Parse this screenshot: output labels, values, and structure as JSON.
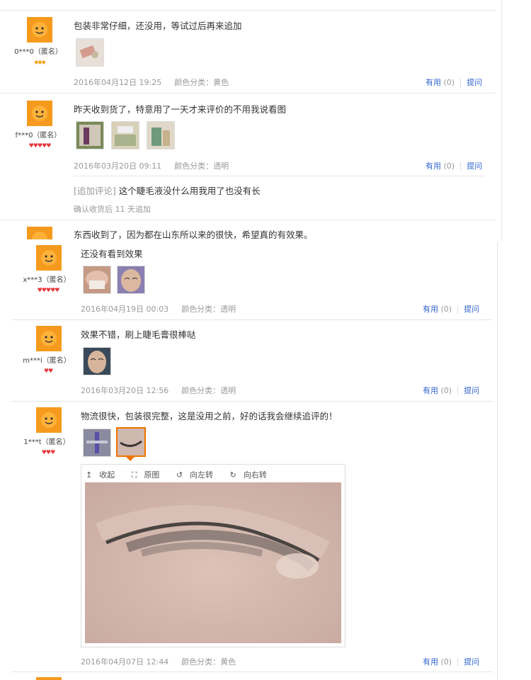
{
  "reviews": [
    {
      "user": "0***0（匿名）",
      "content": "包装非常仔细，还没用，等试过后再来追加",
      "date": "2016年04月12日 19:25",
      "color_label": "颜色分类：",
      "color_value": "黄色",
      "useful_label": "有用",
      "useful_count": "(0)",
      "ask_label": "提问",
      "rank": "◆◆◆"
    },
    {
      "user": "f***0（匿名）",
      "content": "昨天收到货了，特意用了一天才来评价的不用我说看图",
      "date": "2016年03月20日 09:11",
      "color_label": "颜色分类：",
      "color_value": "透明",
      "useful_label": "有用",
      "useful_count": "(0)",
      "ask_label": "提问",
      "append_label": "[追加评论]",
      "append_text": "这个睫毛液没什么用我用了也没有长",
      "append_meta": "确认收货后 11 天追加",
      "rank": "♥♥♥♥♥"
    },
    {
      "content": "东西收到了，因为都在山东所以来的很快，希望真的有效果。"
    },
    {
      "user": "x***3（匿名）",
      "content": "还没有看到效果",
      "date": "2016年04月19日 00:03",
      "color_label": "颜色分类：",
      "color_value": "透明",
      "useful_label": "有用",
      "useful_count": "(0)",
      "ask_label": "提问",
      "rank": "♥♥♥♥♥"
    },
    {
      "user": "m***i（匿名）",
      "content": "效果不错，刷上睫毛膏很棒哒",
      "date": "2016年03月20日 12:56",
      "color_label": "颜色分类：",
      "color_value": "透明",
      "useful_label": "有用",
      "useful_count": "(0)",
      "ask_label": "提问",
      "rank": "♥♥"
    },
    {
      "user": "1***t（匿名）",
      "content": "物流很快，包装很完整，这是没用之前，好的话我会继续追评的！",
      "date": "2016年04月07日 12:44",
      "color_label": "颜色分类：",
      "color_value": "黄色",
      "useful_label": "有用",
      "useful_count": "(0)",
      "ask_label": "提问",
      "rank": "♥♥♥"
    }
  ],
  "zoom_tools": {
    "collapse": "收起",
    "original": "原图",
    "rotate_left": "向左转",
    "rotate_right": "向右转"
  },
  "colors": {
    "link": "#3366cc",
    "meta": "#999999",
    "selected_border": "#f07400",
    "avatar_orange": "#f59a1d"
  }
}
